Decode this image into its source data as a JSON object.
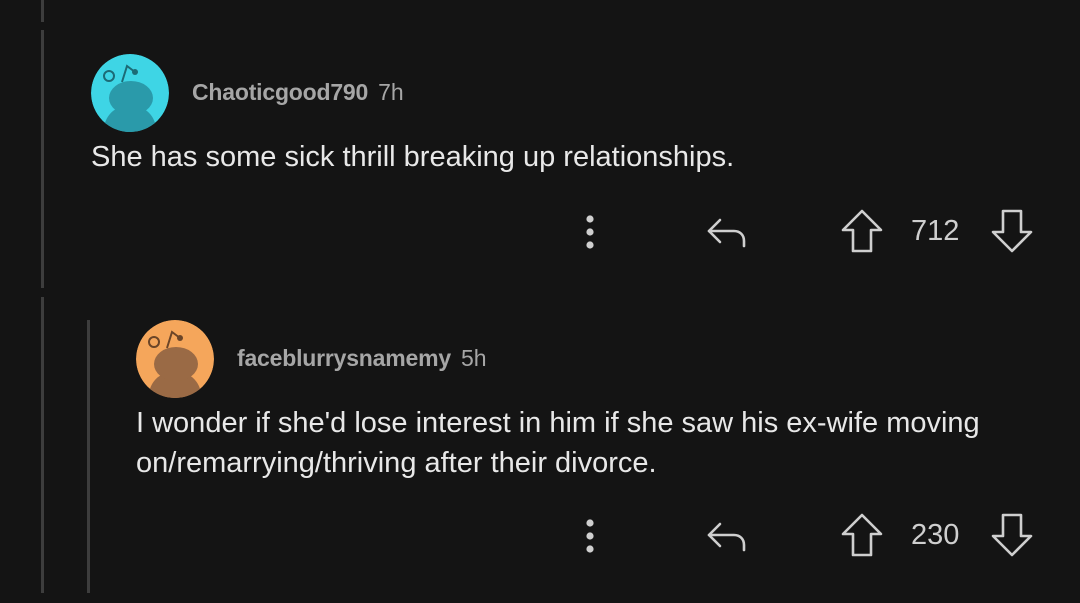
{
  "comments": [
    {
      "username": "Chaoticgood790",
      "time": "7h",
      "body": "She has some sick thrill breaking up relationships.",
      "score": "712",
      "avatar_color": "#3ed5e5"
    },
    {
      "username": "faceblurrysnamemy",
      "time": "5h",
      "body": "I wonder if she'd lose interest in him if she saw his ex-wife moving on/remarrying/thriving after their divorce.",
      "score": "230",
      "avatar_color": "#f5a65b"
    }
  ],
  "icons": {
    "more": "more-options-icon",
    "reply": "reply-icon",
    "upvote": "upvote-icon",
    "downvote": "downvote-icon"
  },
  "colors": {
    "background": "#141414",
    "thread_line": "#3d3d3d",
    "text": "#e8e8e8",
    "meta": "#a6a6a6"
  }
}
